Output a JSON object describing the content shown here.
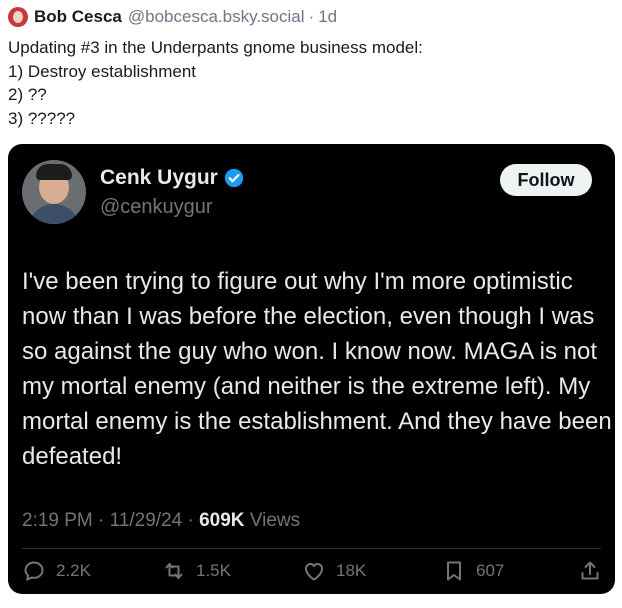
{
  "post": {
    "author_name": "Bob Cesca",
    "author_handle": "@bobcesca.bsky.social",
    "separator": "·",
    "time": "1d",
    "lines": [
      "Updating #3 in the Underpants gnome business model:",
      "1) Destroy establishment",
      "2) ??",
      "3) ?????"
    ]
  },
  "embed": {
    "name": "Cenk Uygur",
    "handle": "@cenkuygur",
    "follow_label": "Follow",
    "text": "I've been trying to figure out why I'm more optimistic now than I was before the election, even though I was so against the guy who won. I know now. MAGA is not my mortal enemy (and neither is the extreme left). My mortal enemy is the establishment. And they have been defeated!",
    "time": "2:19 PM",
    "date": "11/29/24",
    "views_count": "609K",
    "views_label": "Views",
    "replies": "2.2K",
    "reposts": "1.5K",
    "likes": "18K",
    "bookmarks": "607",
    "verified_color": "#1d9bf0"
  }
}
